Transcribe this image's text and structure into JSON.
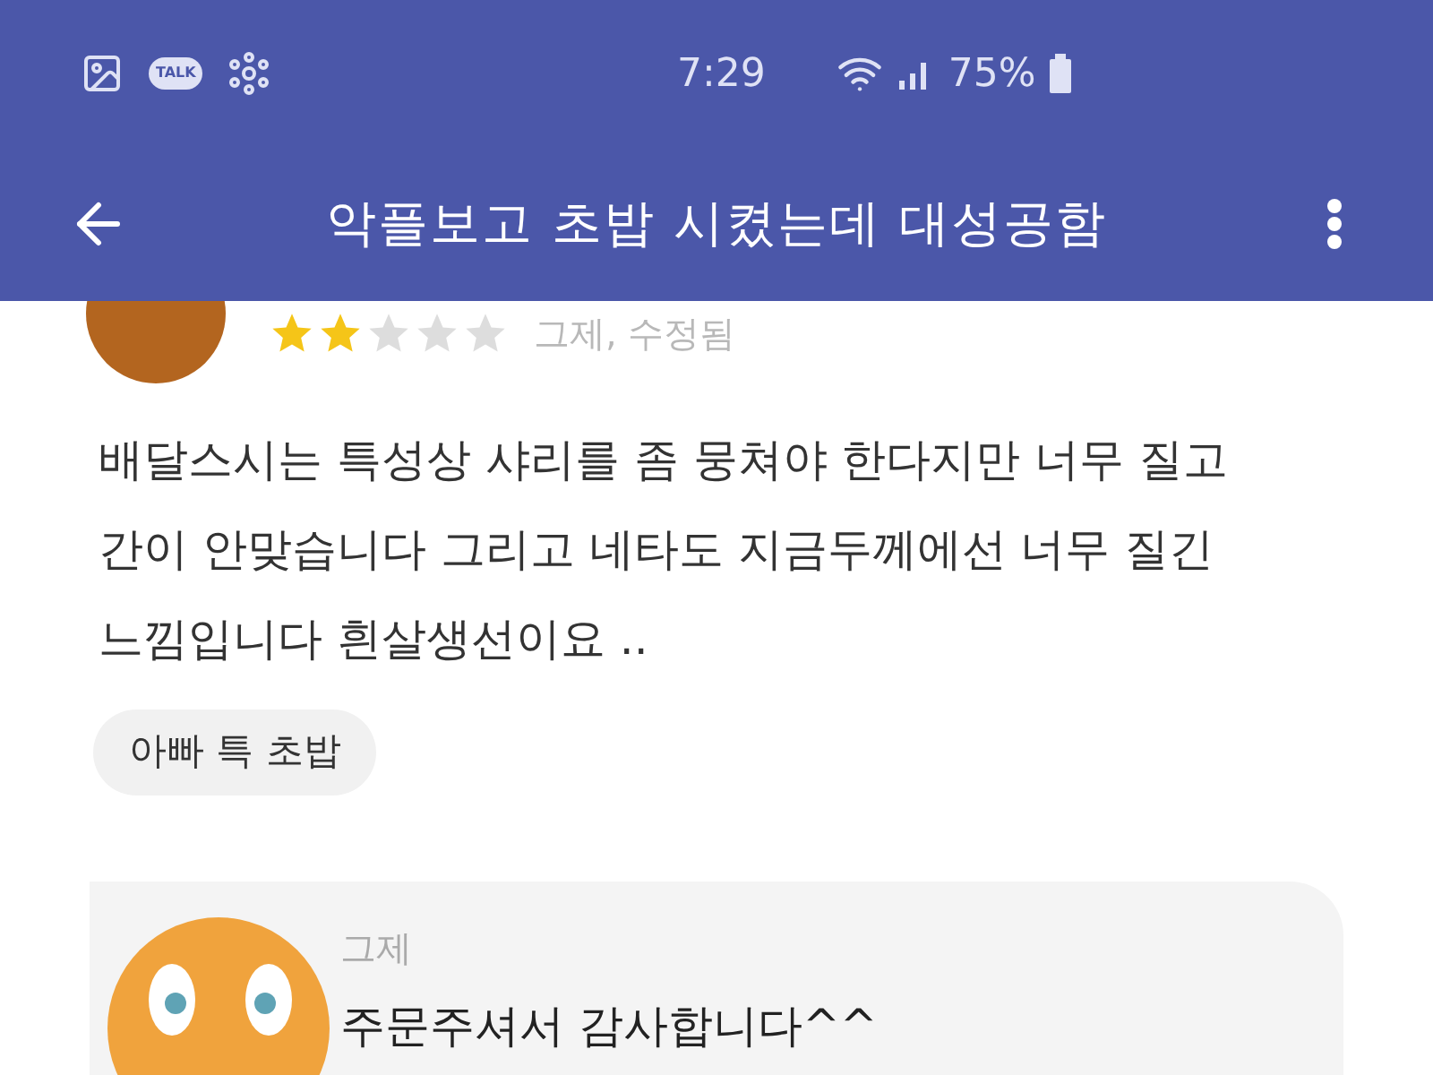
{
  "status_bar": {
    "talk_label": "TALK",
    "time": "7:29",
    "battery": "75%"
  },
  "app_bar": {
    "title": "악플보고 초밥 시켰는데 대성공함"
  },
  "review": {
    "stars": 2,
    "date": "그제, 수정됨",
    "text": "배달스시는 특성상 샤리를 좀 뭉쳐야 한다지만 너무 질고 간이 안맞습니다 그리고 네타도 지금두께에선 너무 질긴 느낌입니다 흰살생선이요 ..",
    "tags": [
      "아빠 특 초밥"
    ]
  },
  "reply": {
    "date": "그제",
    "text": "주문주셔서 감사합니다^^"
  }
}
